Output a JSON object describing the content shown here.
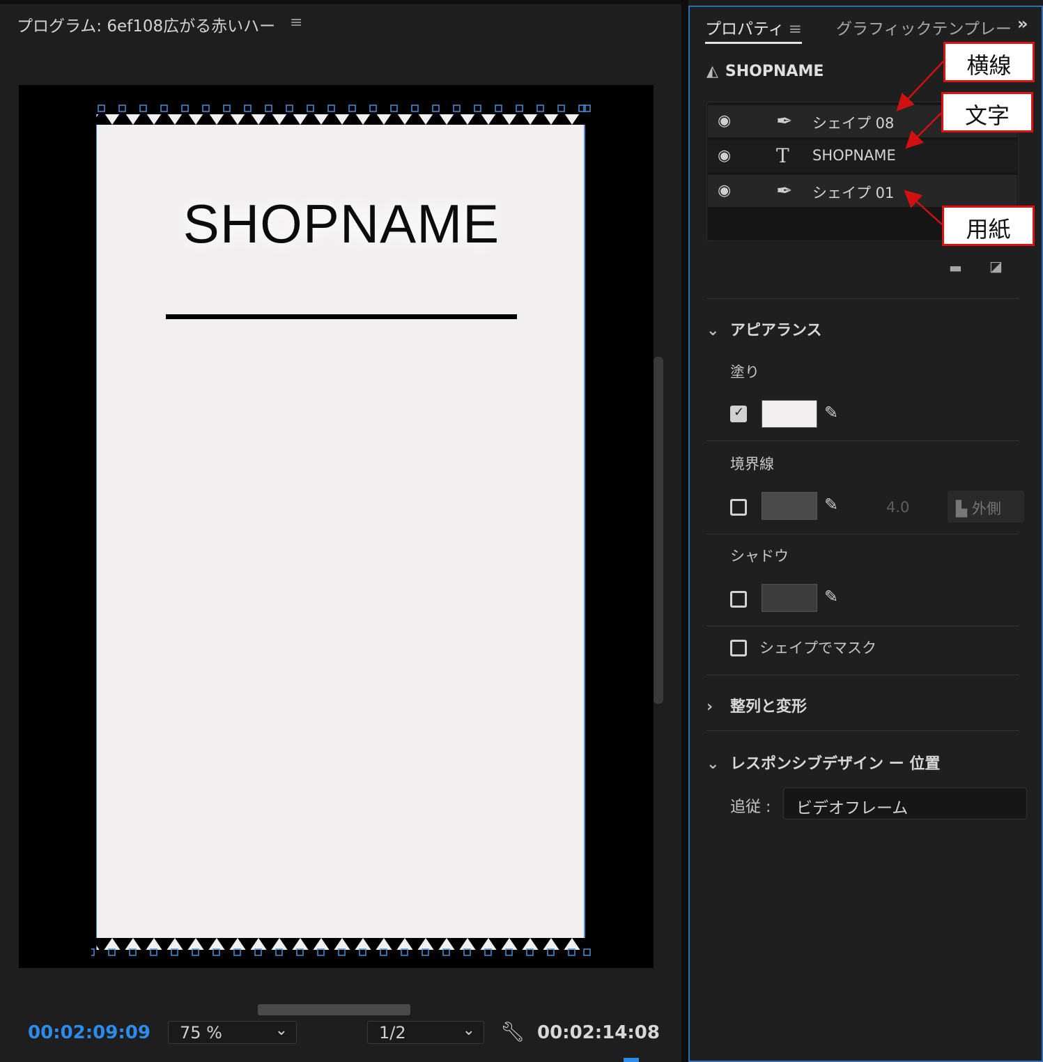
{
  "program": {
    "title": "プログラム: 6ef108広がる赤いハー",
    "menu_glyph": "≡",
    "timecode_current": "00:02:09:09",
    "zoom": "75 %",
    "resolution": "1/2",
    "timecode_total": "00:02:14:08",
    "canvas_text": "SHOPNAME"
  },
  "properties": {
    "tabs": [
      {
        "label": "プロパティ",
        "active": true
      },
      {
        "label": "グラフィックテンプレート",
        "active": false
      }
    ],
    "tab_menu_glyph": "≡",
    "overflow_glyph": "»",
    "layer_header": "SHOPNAME",
    "layers": [
      {
        "name": "シェイプ 08",
        "icon": "pen-icon"
      },
      {
        "name": "SHOPNAME",
        "icon": "text-icon"
      },
      {
        "name": "シェイプ 01",
        "icon": "pen-icon"
      }
    ],
    "appearance": {
      "title": "アピアランス",
      "fill_label": "塗り",
      "fill_checked": true,
      "fill_color": "#f1eff0",
      "stroke_label": "境界線",
      "stroke_checked": false,
      "stroke_color": "#4a4a4a",
      "stroke_width": "4.0",
      "stroke_position": "外側",
      "shadow_label": "シャドウ",
      "shadow_checked": false,
      "shadow_color": "#3c3c3c",
      "mask_label": "シェイプでマスク",
      "mask_checked": false
    },
    "align_transform": {
      "title": "整列と変形"
    },
    "responsive": {
      "title": "レスポンシブデザイン ー 位置",
      "follow_label": "追従 :",
      "follow_value": "ビデオフレーム"
    }
  },
  "annotations": {
    "horizontal_line": "横線",
    "text": "文字",
    "paper": "用紙"
  },
  "colors": {
    "accent_blue": "#2d8ceb",
    "annotation_red": "#d11111"
  }
}
